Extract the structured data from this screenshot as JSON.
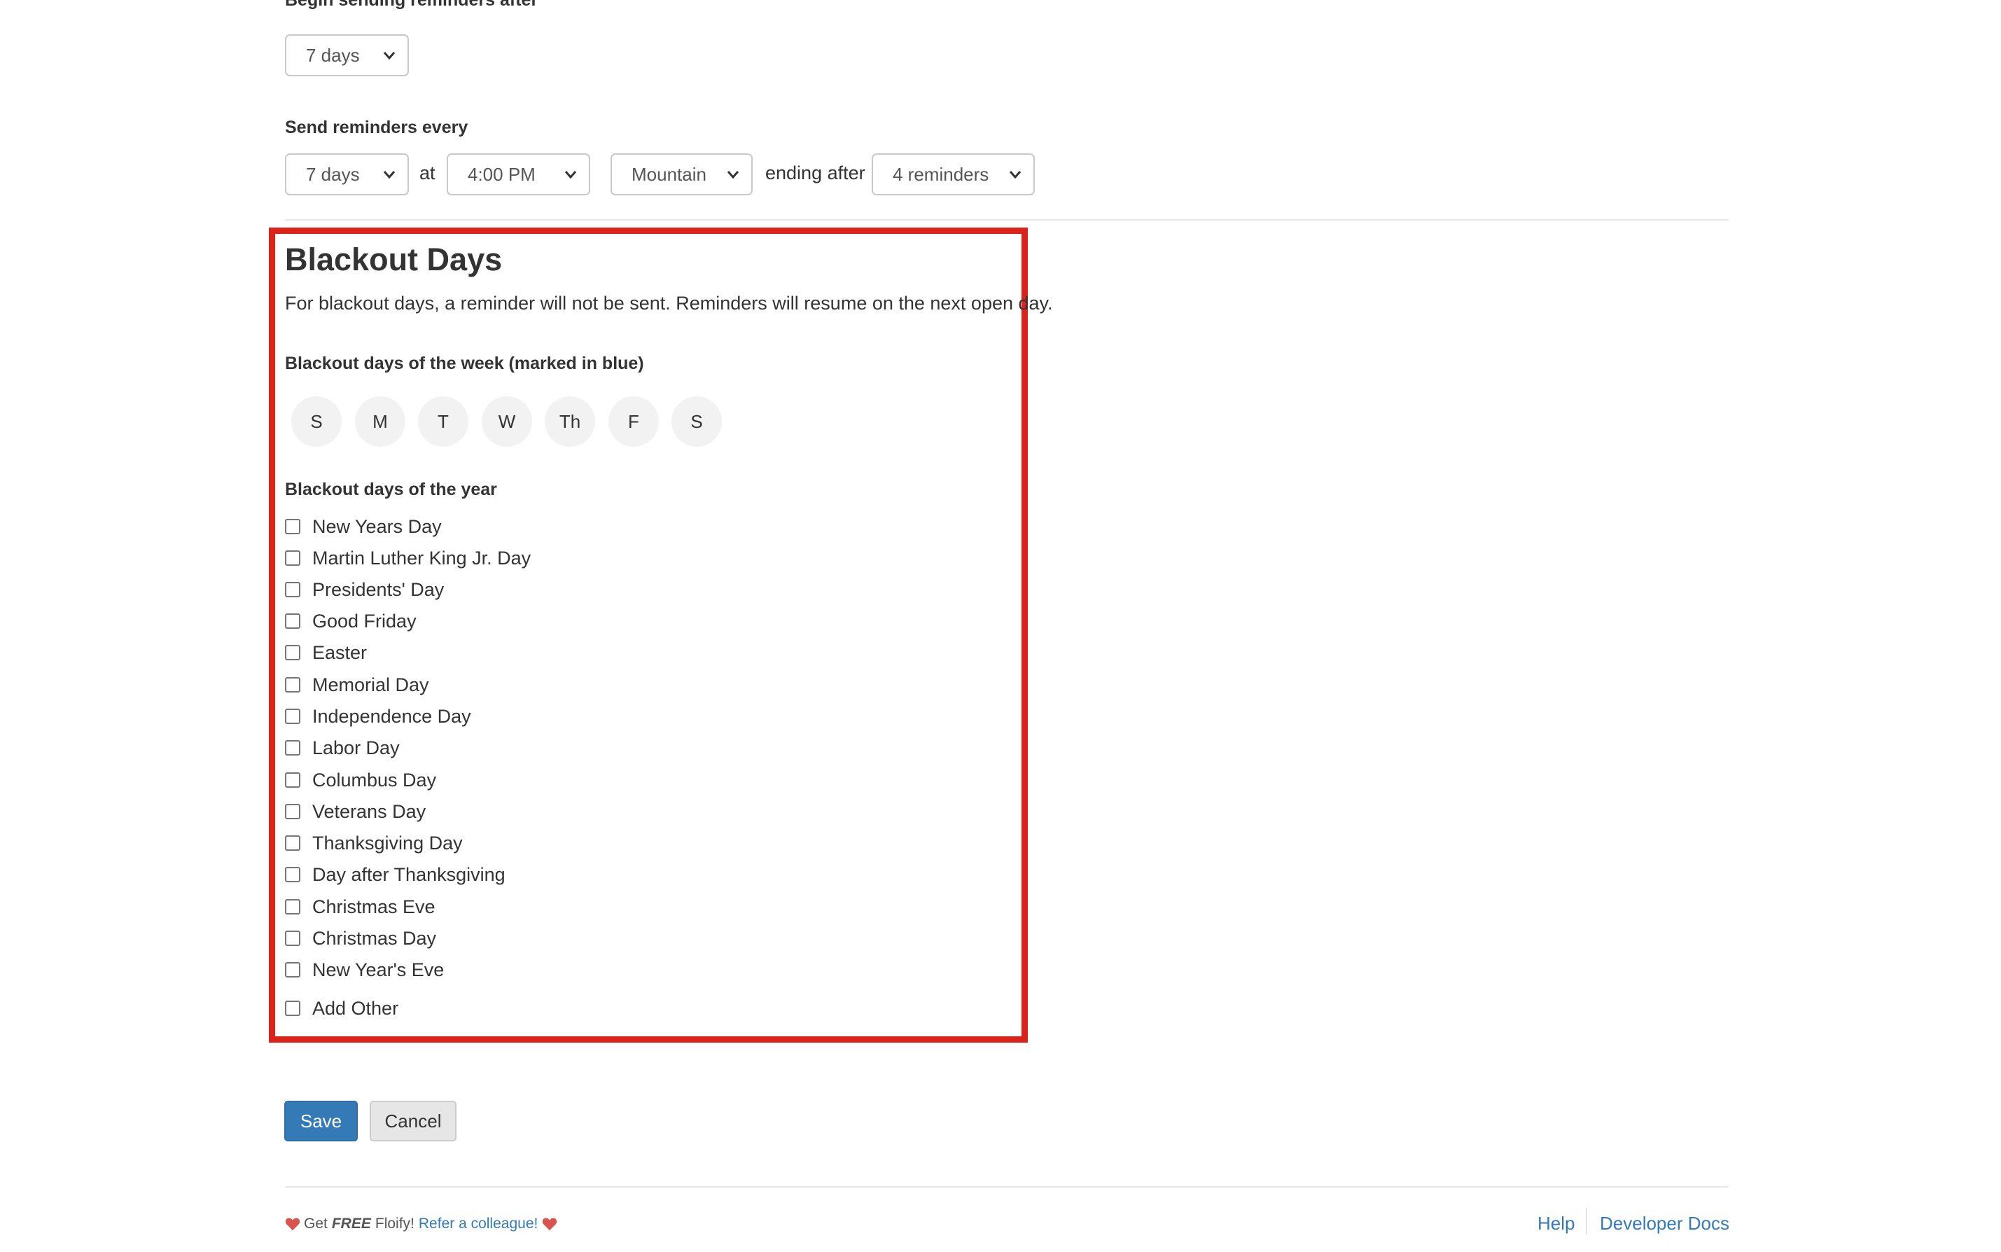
{
  "begin_section": {
    "label": "Begin sending reminders after",
    "delay_select": "7 days"
  },
  "repeat_section": {
    "label": "Send reminders every",
    "interval_select": "7 days",
    "at_text": "at",
    "time_select": "4:00 PM",
    "timezone_select": "Mountain",
    "ending_text": "ending after",
    "count_select": "4 reminders"
  },
  "blackout": {
    "title": "Blackout Days",
    "description": "For blackout days, a reminder will not be sent. Reminders will resume on the next open day.",
    "week_label": "Blackout days of the week (marked in blue)",
    "week_days": [
      "S",
      "M",
      "T",
      "W",
      "Th",
      "F",
      "S"
    ],
    "year_label": "Blackout days of the year",
    "holidays": [
      "New Years Day",
      "Martin Luther King Jr. Day",
      "Presidents' Day",
      "Good Friday",
      "Easter",
      "Memorial Day",
      "Independence Day",
      "Labor Day",
      "Columbus Day",
      "Veterans Day",
      "Thanksgiving Day",
      "Day after Thanksgiving",
      "Christmas Eve",
      "Christmas Day",
      "New Year's Eve"
    ],
    "add_other": "Add Other"
  },
  "actions": {
    "save": "Save",
    "cancel": "Cancel"
  },
  "footer": {
    "get": "Get",
    "free": "FREE",
    "product": "Floify!",
    "refer_link": "Refer a colleague!",
    "help": "Help",
    "developer_docs": "Developer Docs"
  },
  "colors": {
    "highlight_border": "#dd2219",
    "primary_button": "#337ab7",
    "link": "#337ab7",
    "heart": "#d9534f"
  },
  "icons": {
    "select_arrow": "chevron-down-icon",
    "heart": "heart-icon"
  }
}
